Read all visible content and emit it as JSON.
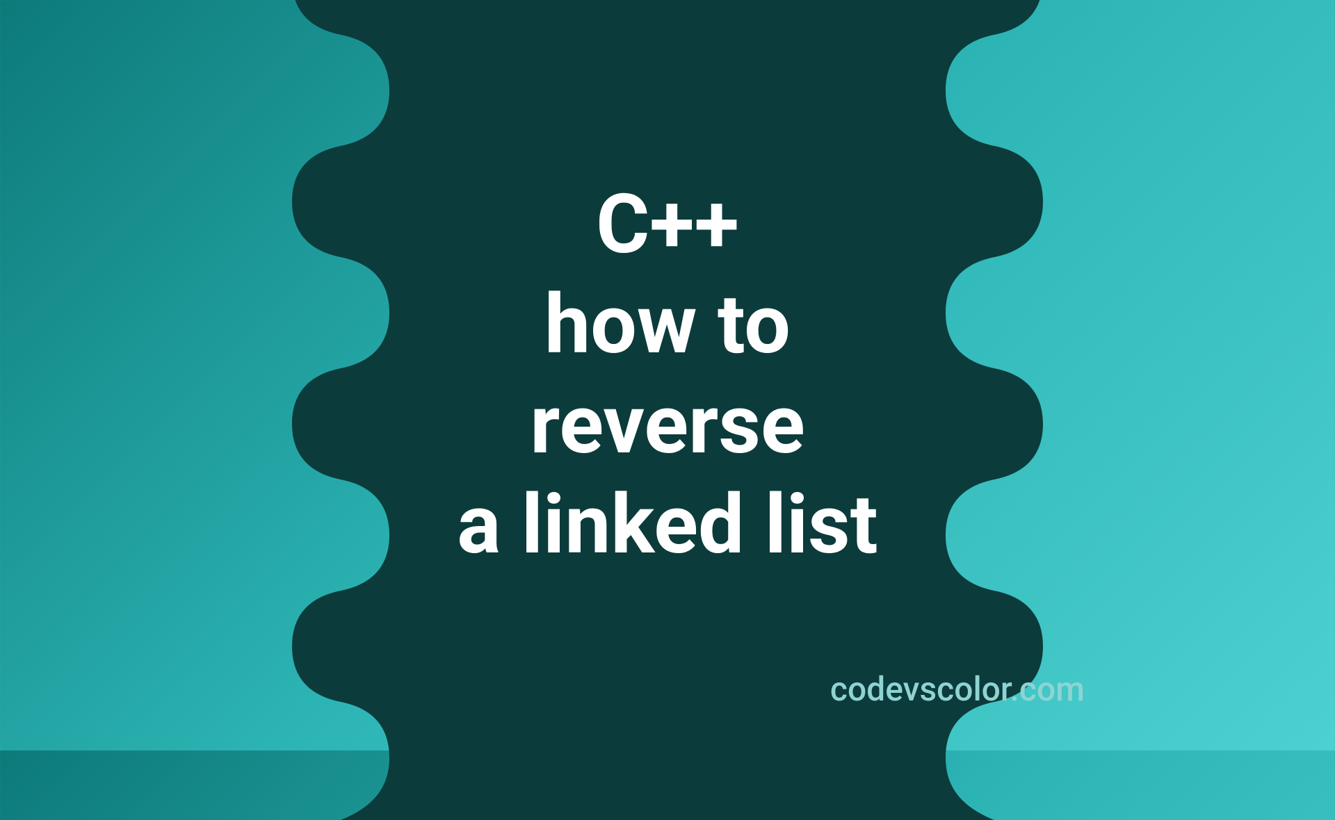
{
  "title": {
    "line1": "C++",
    "line2": "how to",
    "line3": "reverse",
    "line4": "a linked list"
  },
  "watermark": "codevscolor.com",
  "colors": {
    "blob": "#0c3b3b",
    "text": "#ffffff",
    "watermark": "#8fd3d3"
  }
}
